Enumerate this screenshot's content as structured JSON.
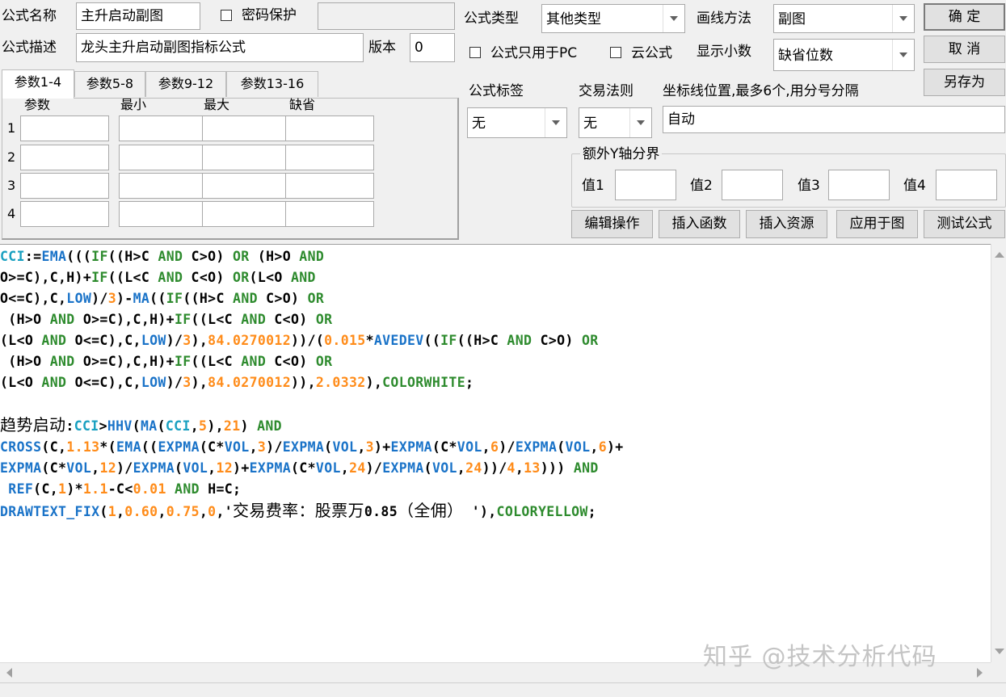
{
  "form": {
    "name_label": "公式名称",
    "name_value": "主升启动副图",
    "password_label": "密码保护",
    "desc_label": "公式描述",
    "desc_value": "龙头主升启动副图指标公式",
    "version_label": "版本",
    "version_value": "0",
    "type_label": "公式类型",
    "type_value": "其他类型",
    "draw_label": "画线方法",
    "draw_value": "副图",
    "pc_only_label": "公式只用于PC",
    "cloud_label": "云公式",
    "decimals_label": "显示小数",
    "decimals_value": "缺省位数",
    "tag_label": "公式标签",
    "tag_value": "无",
    "rule_label": "交易法则",
    "rule_value": "无",
    "axis_label": "坐标线位置,最多6个,用分号分隔",
    "axis_value": "自动",
    "y_group_label": "额外Y轴分界",
    "y_values": [
      "值1",
      "值2",
      "值3",
      "值4"
    ]
  },
  "buttons": {
    "ok": "确  定",
    "cancel": "取  消",
    "save_as": "另存为",
    "edit": "编辑操作",
    "insert_func": "插入函数",
    "insert_res": "插入资源",
    "apply": "应用于图",
    "test": "测试公式"
  },
  "tabs": [
    "参数1-4",
    "参数5-8",
    "参数9-12",
    "参数13-16"
  ],
  "params": {
    "headers": [
      "参数",
      "最小",
      "最大",
      "缺省"
    ],
    "rows": [
      "1",
      "2",
      "3",
      "4"
    ]
  },
  "watermark": "知乎 @技术分析代码",
  "colors": {
    "keyword": "#2e8b2e",
    "function": "#1a73c8",
    "variable": "#19a0c0",
    "number": "#ff8c1a"
  }
}
